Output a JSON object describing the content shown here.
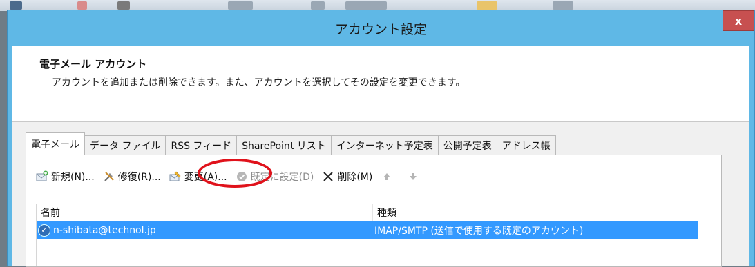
{
  "window": {
    "title": "アカウント設定",
    "close_label": "x"
  },
  "header": {
    "title": "電子メール アカウント",
    "description": "アカウントを追加または削除できます。また、アカウントを選択してその設定を変更できます。"
  },
  "tabs": [
    {
      "label": "電子メール",
      "active": true
    },
    {
      "label": "データ ファイル",
      "active": false
    },
    {
      "label": "RSS フィード",
      "active": false
    },
    {
      "label": "SharePoint リスト",
      "active": false
    },
    {
      "label": "インターネット予定表",
      "active": false
    },
    {
      "label": "公開予定表",
      "active": false
    },
    {
      "label": "アドレス帳",
      "active": false
    }
  ],
  "toolbar": {
    "new_label": "新規(N)...",
    "repair_label": "修復(R)...",
    "change_label": "変更(A)...",
    "set_default_label": "既定に設定(D)",
    "delete_label": "削除(M)",
    "move_up_icon": "arrow-up-icon",
    "move_down_icon": "arrow-down-icon"
  },
  "list": {
    "columns": {
      "name": "名前",
      "type": "種類"
    },
    "rows": [
      {
        "name": "n-shibata@technol.jp",
        "type": "IMAP/SMTP (送信で使用する既定のアカウント)",
        "selected": true
      }
    ]
  },
  "colors": {
    "title_bar": "#5fb8e6",
    "selection": "#3399ff",
    "close_button": "#c75050",
    "highlight_ring": "#e0121b"
  }
}
